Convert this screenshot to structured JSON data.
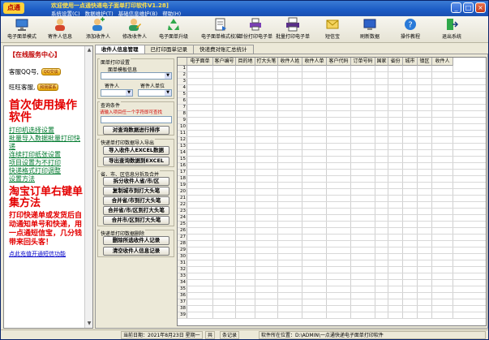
{
  "window": {
    "logo": "点通",
    "title": "欢迎使用一点通快递电子面单打印软件V1.28]",
    "menus": [
      "系统设置(C)",
      "数据维护(T)",
      "基础信息维护(B)",
      "帮助(H)"
    ]
  },
  "toolbar": {
    "items": [
      {
        "label": "电子面单模式",
        "icon": "monitor-icon"
      },
      {
        "label": "寄件人信息",
        "icon": "sender-icon"
      },
      {
        "label": "添加收件人",
        "icon": "add-recipient-icon"
      },
      {
        "label": "修改收件人",
        "icon": "edit-recipient-icon"
      },
      {
        "label": "电子面单升级",
        "icon": "recycle-icon"
      },
      {
        "label": "电子面单格式校准",
        "icon": "calibrate-icon"
      },
      {
        "label": "单份打印电子单",
        "icon": "print-single-icon"
      },
      {
        "label": "批量打印电子单",
        "icon": "print-batch-icon"
      },
      {
        "label": "短信宝",
        "icon": "sms-icon"
      },
      {
        "label": "刷新数据",
        "icon": "refresh-icon"
      },
      {
        "label": "操作教程",
        "icon": "help-icon"
      },
      {
        "label": "退出系统",
        "icon": "exit-icon"
      }
    ]
  },
  "sidebar": {
    "online_title": "【在线服务中心】",
    "qq_label": "客服QQ号,",
    "qq_badge": "QQ交谈",
    "wangwang_label": "旺旺客服,",
    "wangwang_badge": "和我联系",
    "headline": "首次使用操作软件",
    "links": [
      "打印机选择设置",
      "批量导入数据批量打印快递",
      "连续打印纸张设置",
      "项目设置为不打印",
      "快递格式打印调整",
      "设置方法"
    ],
    "taobao": "淘宝订单右键单集方法",
    "promo": "打印快递单或发货后自动通知单号和快递，用一点通短信宝，几分钱带来回头客！",
    "recharge": "点此充值开通短信功能"
  },
  "tabs": [
    "收件人信息管理",
    "已打印面单记录",
    "快递费对账汇总统计"
  ],
  "controls": {
    "print_settings_title": "面单打印设置",
    "template_label": "面单模板信息",
    "recipient_label": "寄件人",
    "sender_unit_label": "寄件人单位",
    "query_title": "查询条件",
    "query_hint": "请输入项目任一个字符即可查找",
    "query_button": "对查询数据进行排序",
    "import_title": "快递单打印数据导入导出",
    "import_excel": "导入收件人EXCEL数据",
    "export_excel": "导出查询数据到EXCEL",
    "split_title": "省、市、区信息分拆及合并",
    "split_buttons": [
      "拆分收件人省/市/区",
      "复制城市到打大头笔",
      "合并省/市到打大头笔",
      "合并省/市/区到打大头笔",
      "合并市/区到打大头笔"
    ],
    "delete_title": "快递单打印数据删除",
    "delete_buttons": [
      "删除所选收件人记录",
      "清空收件人信息记录"
    ]
  },
  "grid": {
    "columns": [
      "电子面单",
      "客户编号",
      "目的地",
      "打大头笔",
      "收件人姓",
      "收件人单",
      "客户代码",
      "订单号码",
      "国家",
      "省份",
      "城市",
      "镇区",
      "收件人"
    ],
    "row_numbers": [
      "1",
      "2",
      "3",
      "4",
      "5",
      "6",
      "7",
      "8",
      "9",
      "10",
      "11",
      "12",
      "13",
      "14",
      "15",
      "16",
      "17",
      "18",
      "19",
      "20",
      "21",
      "22",
      "23",
      "24",
      "25",
      "26",
      "27",
      "28",
      "29",
      "30",
      "31",
      "32",
      "33",
      "34",
      "35",
      "36",
      "37",
      "38",
      "39"
    ]
  },
  "status": {
    "date": "当前日期：2021年8月23日 星期一",
    "total_label": "共",
    "records_label": "条记录",
    "path": "软件所在位置：D:\\ADMIN\\一点通快递电子面单打印软件"
  }
}
